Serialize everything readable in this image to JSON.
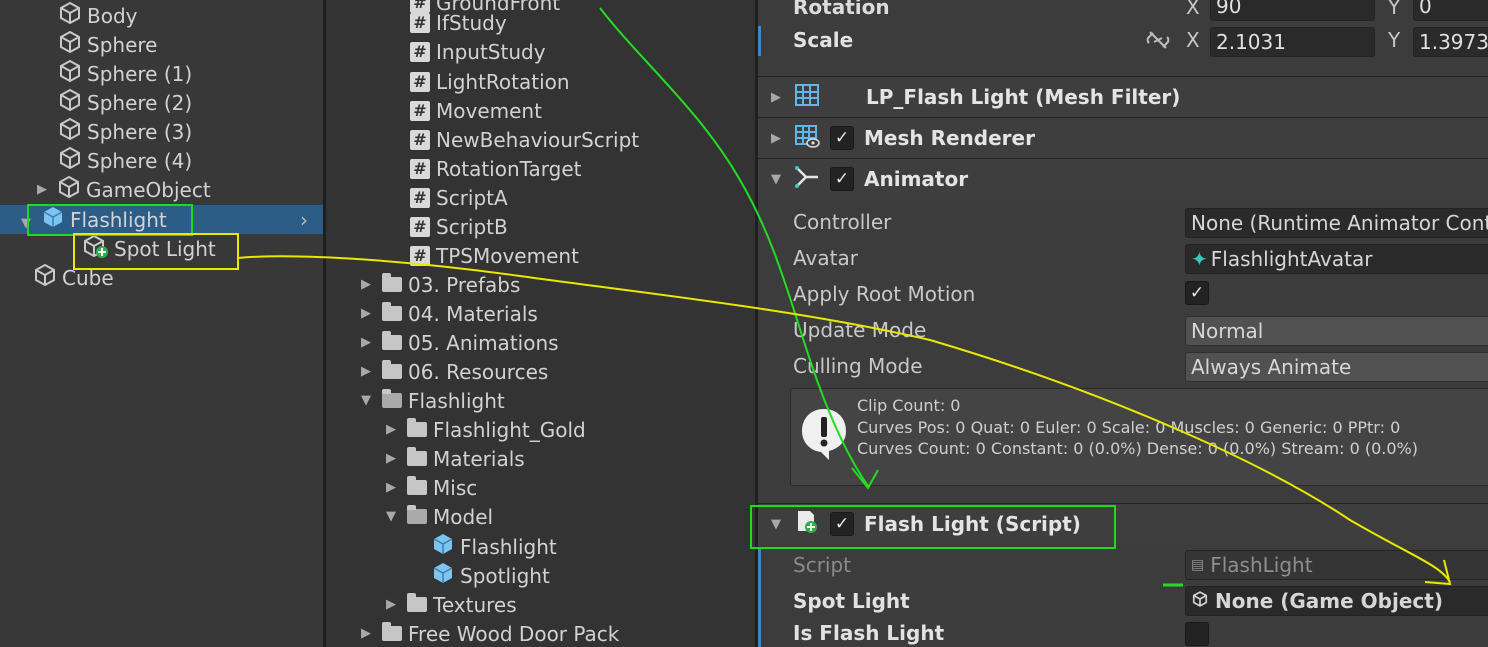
{
  "hierarchy": {
    "items": [
      {
        "label": "Body"
      },
      {
        "label": "Sphere"
      },
      {
        "label": "Sphere (1)"
      },
      {
        "label": "Sphere (2)"
      },
      {
        "label": "Sphere (3)"
      },
      {
        "label": "Sphere (4)"
      },
      {
        "label": "GameObject"
      },
      {
        "label": "Flashlight"
      },
      {
        "label": "Spot Light"
      },
      {
        "label": "Cube"
      }
    ]
  },
  "project": {
    "scripts": [
      "GroundFront",
      "IfStudy",
      "InputStudy",
      "LightRotation",
      "Movement",
      "NewBehaviourScript",
      "RotationTarget",
      "ScriptA",
      "ScriptB",
      "TPSMovement"
    ],
    "folders_top": [
      "03. Prefabs",
      "04. Materials",
      "05. Animations",
      "06. Resources"
    ],
    "flashlight_folder": "Flashlight",
    "flashlight_children": [
      "Flashlight_Gold",
      "Materials",
      "Misc"
    ],
    "model_folder": "Model",
    "model_children": [
      "Flashlight",
      "Spotlight"
    ],
    "textures": "Textures",
    "free_wood": "Free Wood Door Pack"
  },
  "inspector": {
    "rotation_label": "Rotation",
    "rotation_x": "90",
    "rotation_y": "0",
    "scale_label": "Scale",
    "scale_x": "2.1031",
    "scale_y": "1.3973",
    "axis_x": "X",
    "axis_y": "Y",
    "mesh_filter": "LP_Flash Light (Mesh Filter)",
    "mesh_renderer": "Mesh Renderer",
    "animator": "Animator",
    "animator_fields": {
      "controller_label": "Controller",
      "controller_value": "None (Runtime Animator Controller)",
      "avatar_label": "Avatar",
      "avatar_value": "FlashlightAvatar",
      "root_motion_label": "Apply Root Motion",
      "update_mode_label": "Update Mode",
      "update_mode_value": "Normal",
      "culling_mode_label": "Culling Mode",
      "culling_mode_value": "Always Animate"
    },
    "info": {
      "line1": "Clip Count: 0",
      "line2": "Curves Pos: 0 Quat: 0 Euler: 0 Scale: 0 Muscles: 0 Generic: 0 PPtr: 0",
      "line3": "Curves Count: 0 Constant: 0 (0.0%) Dense: 0 (0.0%) Stream: 0 (0.0%)"
    },
    "script_comp": "Flash Light (Script)",
    "script_label": "Script",
    "script_value": "FlashLight",
    "spot_light_label": "Spot Light",
    "spot_light_value": "None (Game Object)",
    "is_flash_light_label": "Is Flash Light"
  }
}
